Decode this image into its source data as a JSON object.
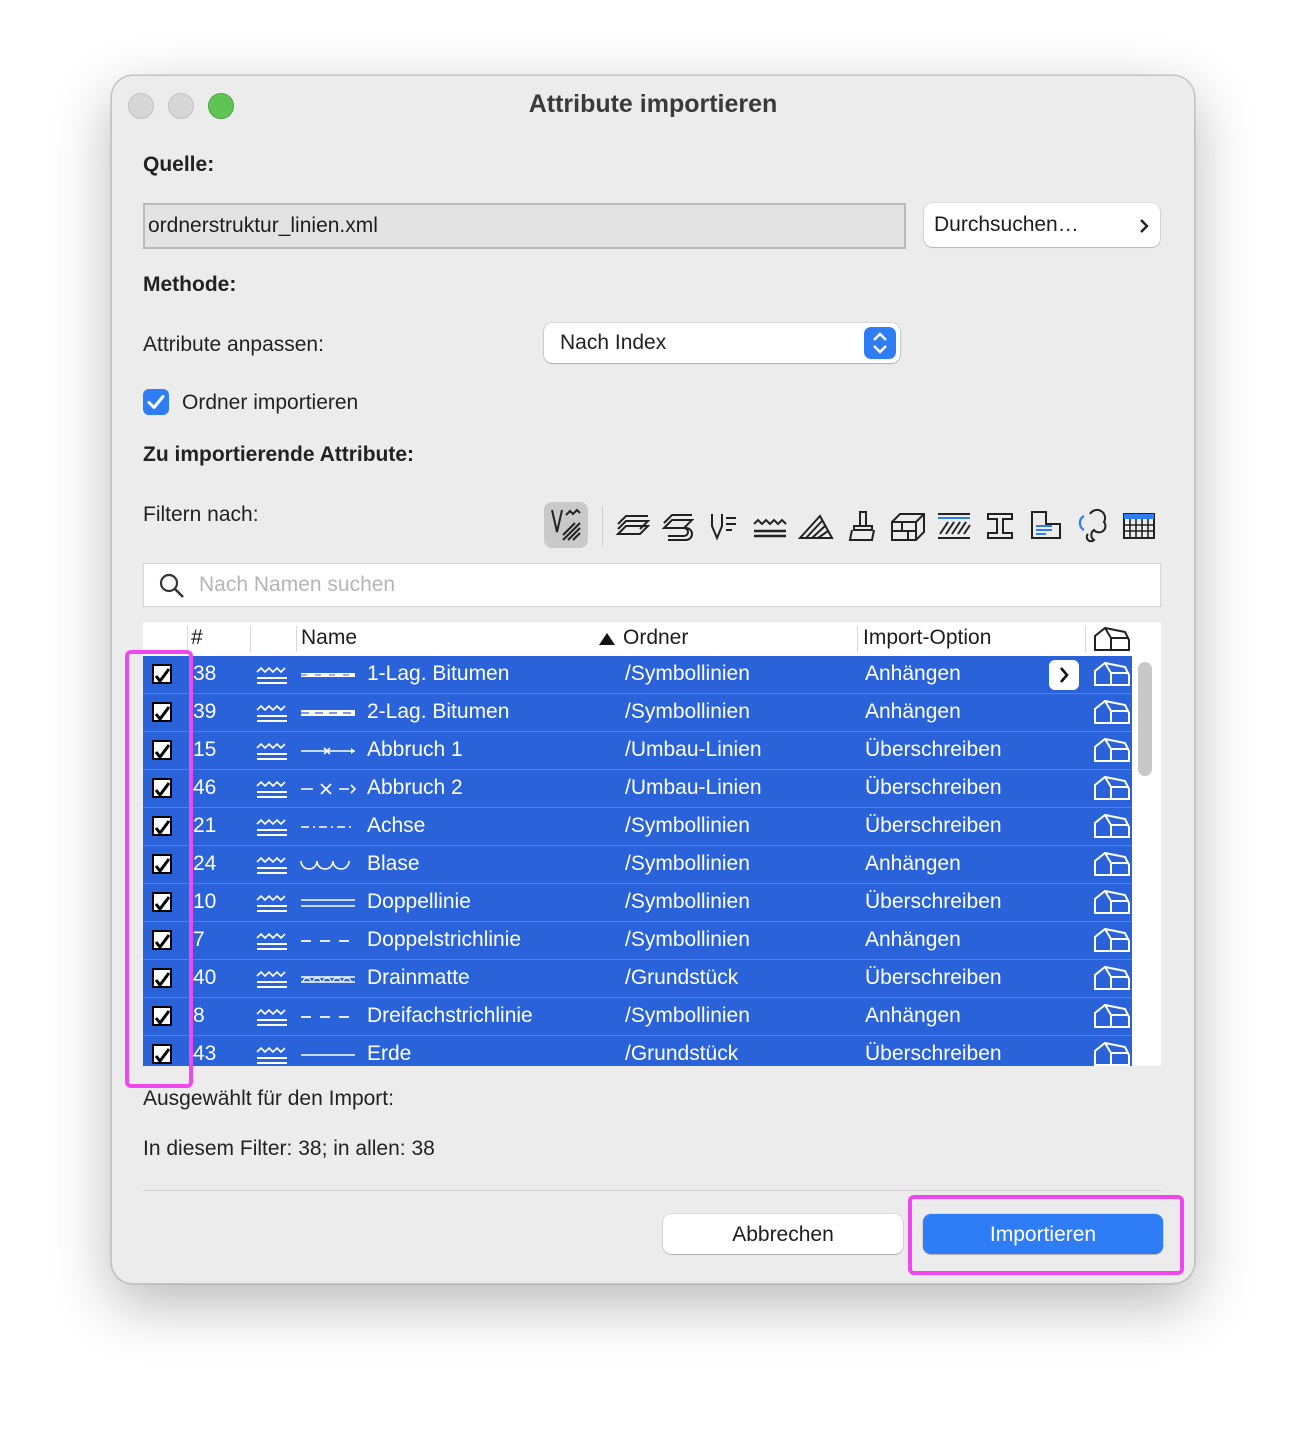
{
  "window": {
    "title": "Attribute importieren"
  },
  "source": {
    "label": "Quelle:",
    "file": "ordnerstruktur_linien.xml",
    "browse_label": "Durchsuchen…"
  },
  "method": {
    "label": "Methode:",
    "match_label": "Attribute anpassen:",
    "match_value": "Nach Index",
    "folders_checkbox_label": "Ordner importieren",
    "folders_checked": true
  },
  "attributes": {
    "label": "Zu importierende Attribute:",
    "filter_label": "Filtern nach:"
  },
  "filter_icons": [
    "all-attributes-icon",
    "layers-icon",
    "layer-combinations-icon",
    "pens-icon",
    "line-types-icon",
    "fill-types-icon",
    "surfaces-icon",
    "building-materials-icon",
    "composites-icon",
    "profiles-icon",
    "zones-icon",
    "markup-icon",
    "operation-profiles-icon"
  ],
  "search": {
    "placeholder": "Nach Namen suchen"
  },
  "table": {
    "columns": {
      "num": "#",
      "name": "Name",
      "folder": "Ordner",
      "option": "Import-Option"
    },
    "rows": [
      {
        "num": "38",
        "name": "1-Lag. Bitumen",
        "folder": "/Symbollinien",
        "option": "Anhängen",
        "checked": true
      },
      {
        "num": "39",
        "name": "2-Lag. Bitumen",
        "folder": "/Symbollinien",
        "option": "Anhängen",
        "checked": true
      },
      {
        "num": "15",
        "name": "Abbruch 1",
        "folder": "/Umbau-Linien",
        "option": "Überschreiben",
        "checked": true
      },
      {
        "num": "46",
        "name": "Abbruch 2",
        "folder": "/Umbau-Linien",
        "option": "Überschreiben",
        "checked": true
      },
      {
        "num": "21",
        "name": "Achse",
        "folder": "/Symbollinien",
        "option": "Überschreiben",
        "checked": true
      },
      {
        "num": "24",
        "name": "Blase",
        "folder": "/Symbollinien",
        "option": "Anhängen",
        "checked": true
      },
      {
        "num": "10",
        "name": "Doppellinie",
        "folder": "/Symbollinien",
        "option": "Überschreiben",
        "checked": true
      },
      {
        "num": "7",
        "name": "Doppelstrichlinie",
        "folder": "/Symbollinien",
        "option": "Anhängen",
        "checked": true
      },
      {
        "num": "40",
        "name": "Drainmatte",
        "folder": "/Grundstück",
        "option": "Überschreiben",
        "checked": true
      },
      {
        "num": "8",
        "name": "Dreifachstrichlinie",
        "folder": "/Symbollinien",
        "option": "Anhängen",
        "checked": true
      },
      {
        "num": "43",
        "name": "Erde",
        "folder": "/Grundstück",
        "option": "Überschreiben",
        "checked": true
      }
    ]
  },
  "summary": {
    "label": "Ausgewählt für den Import:",
    "counts": "In diesem Filter: 38; in allen: 38"
  },
  "buttons": {
    "cancel": "Abbrechen",
    "import": "Importieren"
  },
  "colors": {
    "accent": "#2f7df6",
    "row_selected": "#2a62d9",
    "highlight": "#ef47ef"
  }
}
